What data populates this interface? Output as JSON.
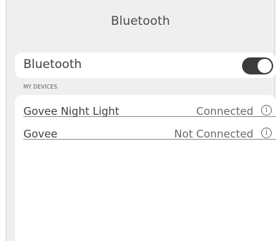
{
  "header": {
    "title": "Bluetooth"
  },
  "bluetooth": {
    "label": "Bluetooth",
    "enabled": true
  },
  "devices_section": {
    "label": "MY DEVICES",
    "items": [
      {
        "name": "Govee Night Light",
        "status": "Connected",
        "icon": "info-icon"
      },
      {
        "name": "Govee",
        "status": "Not Connected",
        "icon": "info-icon"
      }
    ]
  },
  "colors": {
    "background": "#efefef",
    "toggle_on": "#3c3c3c"
  }
}
